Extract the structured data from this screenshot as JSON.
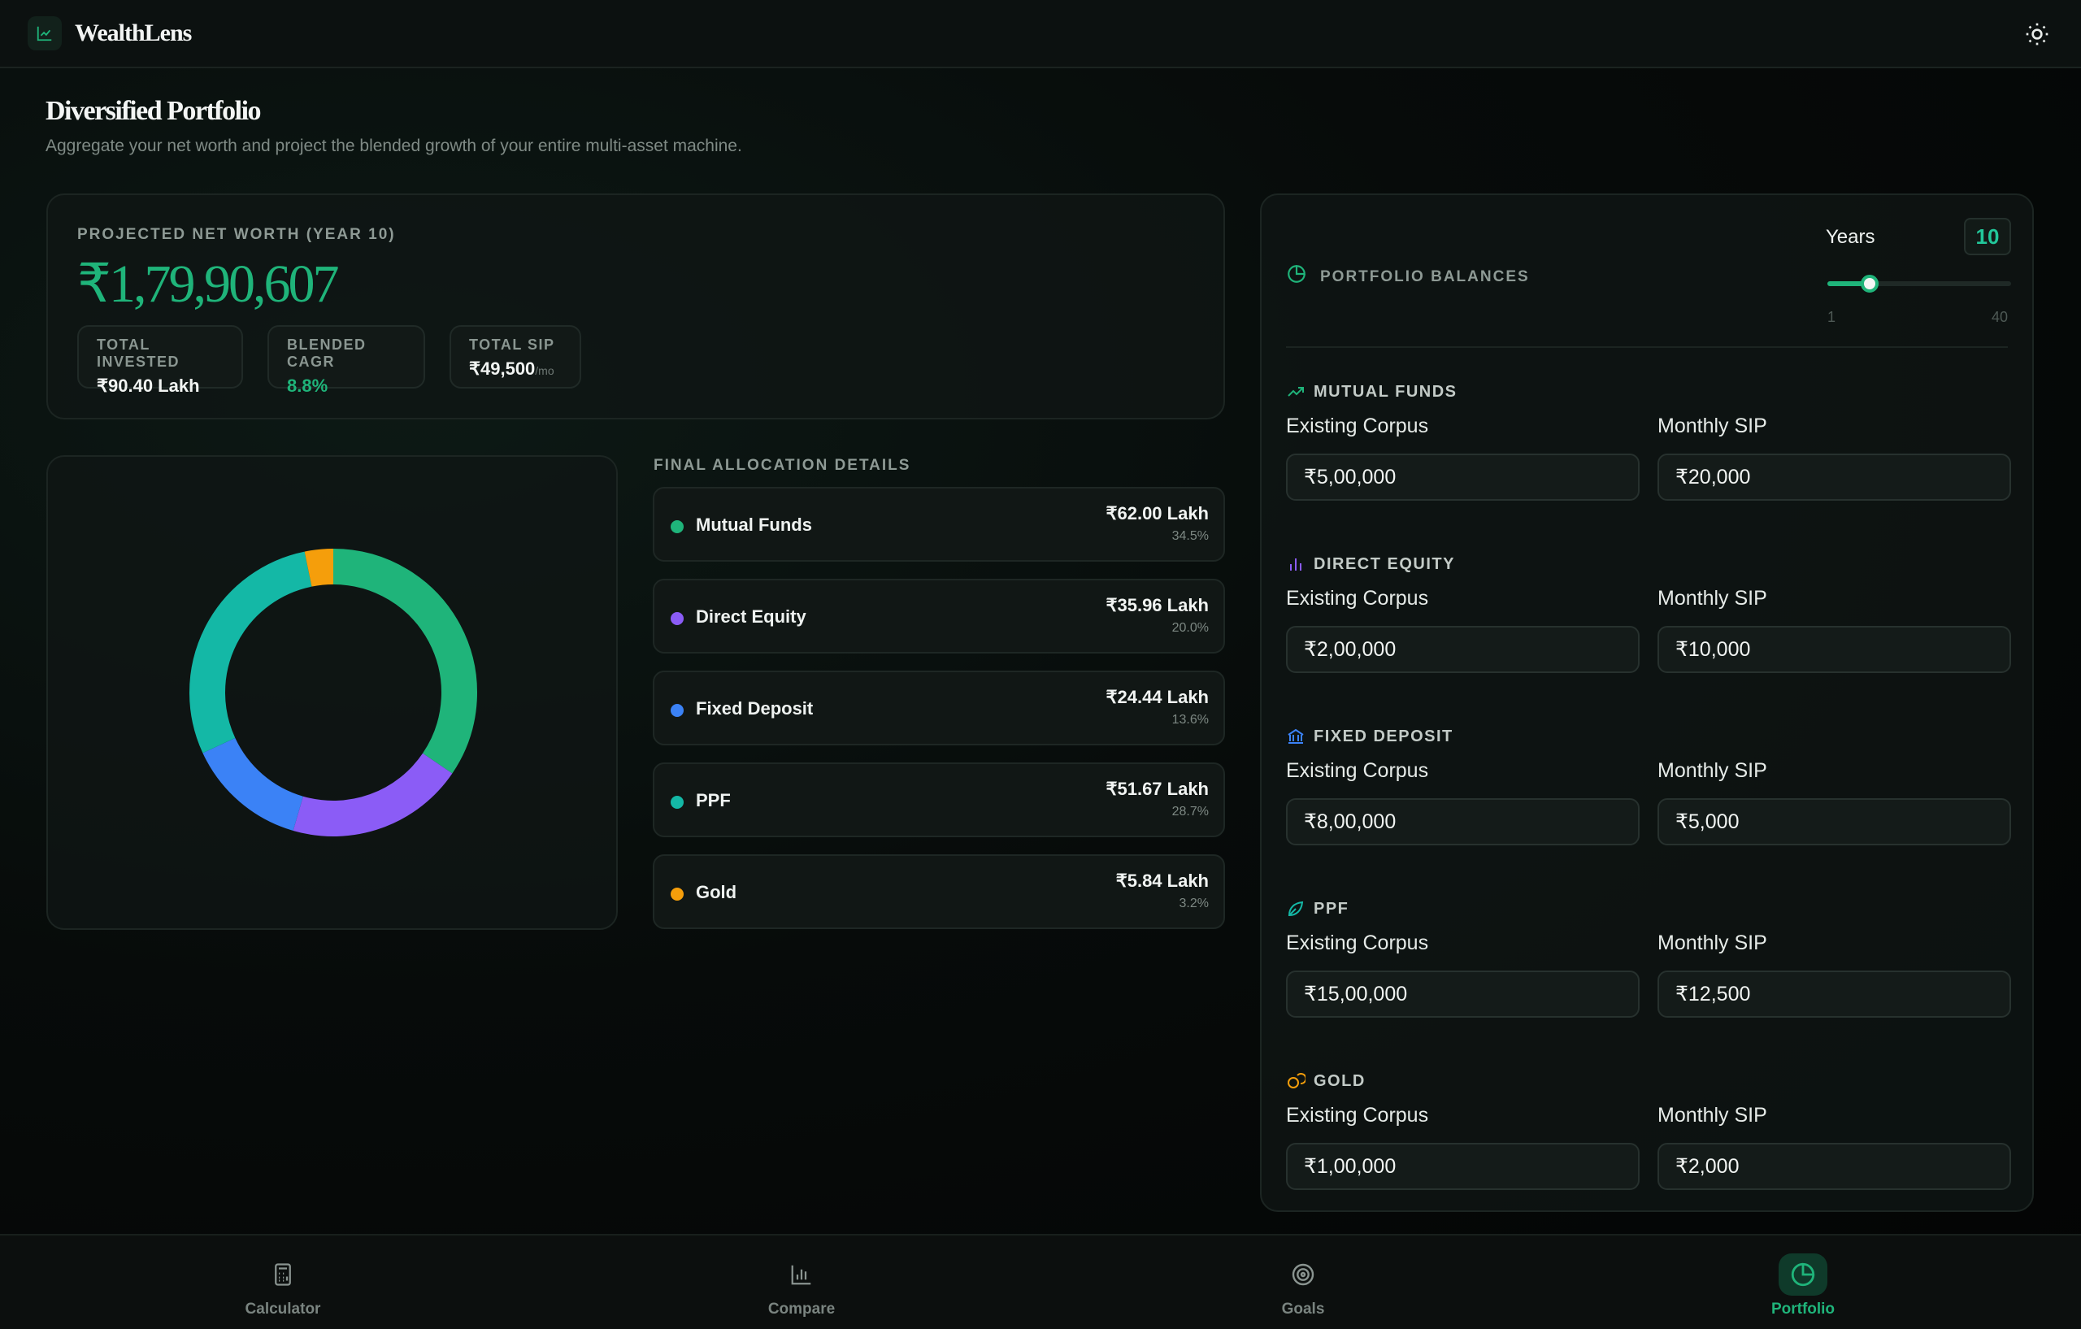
{
  "app": {
    "name": "WealthLens"
  },
  "page": {
    "title": "Diversified Portfolio",
    "subtitle": "Aggregate your net worth and project the blended growth of your entire multi-asset machine."
  },
  "summary": {
    "label": "PROJECTED NET WORTH (YEAR 10)",
    "value": "₹1,79,90,607",
    "stats": [
      {
        "label": "TOTAL INVESTED",
        "value": "₹90.40 Lakh",
        "suffix": ""
      },
      {
        "label": "BLENDED CAGR",
        "value": "8.8%",
        "suffix": ""
      },
      {
        "label": "TOTAL SIP",
        "value": "₹49,500",
        "suffix": "/mo"
      }
    ]
  },
  "allocation": {
    "title": "FINAL ALLOCATION DETAILS",
    "items": [
      {
        "name": "Mutual Funds",
        "amount": "₹62.00 Lakh",
        "percent": "34.5%",
        "share": 34.5,
        "color": "#1fb47a"
      },
      {
        "name": "Direct Equity",
        "amount": "₹35.96 Lakh",
        "percent": "20.0%",
        "share": 20.0,
        "color": "#8b5cf6"
      },
      {
        "name": "Fixed Deposit",
        "amount": "₹24.44 Lakh",
        "percent": "13.6%",
        "share": 13.6,
        "color": "#3b82f6"
      },
      {
        "name": "PPF",
        "amount": "₹51.67 Lakh",
        "percent": "28.7%",
        "share": 28.7,
        "color": "#14b8a6"
      },
      {
        "name": "Gold",
        "amount": "₹5.84 Lakh",
        "percent": "3.2%",
        "share": 3.2,
        "color": "#f59e0b"
      }
    ]
  },
  "balances": {
    "title": "PORTFOLIO BALANCES",
    "years_label": "Years",
    "years_value": "10",
    "slider": {
      "min": "1",
      "max": "40",
      "value": 10
    },
    "field_labels": {
      "corpus": "Existing Corpus",
      "sip": "Monthly SIP"
    },
    "assets": [
      {
        "title": "MUTUAL FUNDS",
        "icon": "trending-up-icon",
        "corpus": "₹5,00,000",
        "sip": "₹20,000",
        "color": "#1fb47a"
      },
      {
        "title": "DIRECT EQUITY",
        "icon": "bar-chart-icon",
        "corpus": "₹2,00,000",
        "sip": "₹10,000",
        "color": "#8b5cf6"
      },
      {
        "title": "FIXED DEPOSIT",
        "icon": "bank-icon",
        "corpus": "₹8,00,000",
        "sip": "₹5,000",
        "color": "#3b82f6"
      },
      {
        "title": "PPF",
        "icon": "leaf-icon",
        "corpus": "₹15,00,000",
        "sip": "₹12,500",
        "color": "#14b8a6"
      },
      {
        "title": "GOLD",
        "icon": "coins-icon",
        "corpus": "₹1,00,000",
        "sip": "₹2,000",
        "color": "#f59e0b"
      }
    ]
  },
  "nav": {
    "items": [
      {
        "label": "Calculator",
        "icon": "calculator-icon",
        "active": false
      },
      {
        "label": "Compare",
        "icon": "bar-chart-icon",
        "active": false
      },
      {
        "label": "Goals",
        "icon": "target-icon",
        "active": false
      },
      {
        "label": "Portfolio",
        "icon": "pie-chart-icon",
        "active": true
      }
    ]
  },
  "colors": {
    "accent": "#1fb47a",
    "background": "#050807"
  }
}
